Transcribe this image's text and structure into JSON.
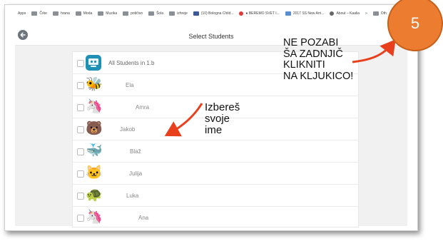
{
  "bookmarks": [
    {
      "label": "Apps",
      "icon": "apps-icon"
    },
    {
      "label": "Črke",
      "icon": "folder-icon"
    },
    {
      "label": "hrana",
      "icon": "folder-icon"
    },
    {
      "label": "Moda",
      "icon": "folder-icon"
    },
    {
      "label": "Muzika",
      "icon": "folder-icon"
    },
    {
      "label": "potičivo",
      "icon": "folder-icon"
    },
    {
      "label": "Šola",
      "icon": "folder-icon"
    },
    {
      "label": "izhreje",
      "icon": "folder-icon"
    },
    {
      "label": "(10) Bologna Child...",
      "icon": "facebook-icon"
    },
    {
      "label": "● BEREMO SVET I...",
      "icon": "red-dot-icon"
    },
    {
      "label": "2017 SS New Arri...",
      "icon": "doc-icon"
    },
    {
      "label": "About – Kaalia",
      "icon": "globe-icon"
    },
    {
      "label": "»",
      "icon": ""
    },
    {
      "label": "Oth",
      "icon": "folder-icon"
    }
  ],
  "header": {
    "title": "Select Students",
    "back_icon": "back-arrow-icon"
  },
  "students": [
    {
      "name": "All Students in 1.b",
      "avatar": "class-icon",
      "glyph": "",
      "checked": false
    },
    {
      "name": "Ela",
      "avatar": "bee",
      "glyph": "🐝",
      "checked": false
    },
    {
      "name": "Amra",
      "avatar": "unicorn",
      "glyph": "🦄",
      "checked": false
    },
    {
      "name": "Jakob",
      "avatar": "bear",
      "glyph": "🐻",
      "checked": false
    },
    {
      "name": "Blaž",
      "avatar": "whale",
      "glyph": "🐳",
      "checked": false
    },
    {
      "name": "Julija",
      "avatar": "cat",
      "glyph": "🐱",
      "checked": false
    },
    {
      "name": "Luka",
      "avatar": "turtle",
      "glyph": "🐢",
      "checked": false
    },
    {
      "name": "Ana",
      "avatar": "unicorn",
      "glyph": "🦄",
      "checked": false
    }
  ],
  "annotations": {
    "reminder": [
      "NE POZABI",
      "ŠA ZADNJIČ",
      "KLIKNITI",
      "NA KLJUKICO!"
    ],
    "pick": [
      "Izbereš",
      "svoje",
      "ime"
    ],
    "step_number": "5",
    "arrow_color": "#e8401c",
    "badge_color": "#ec7c30"
  }
}
